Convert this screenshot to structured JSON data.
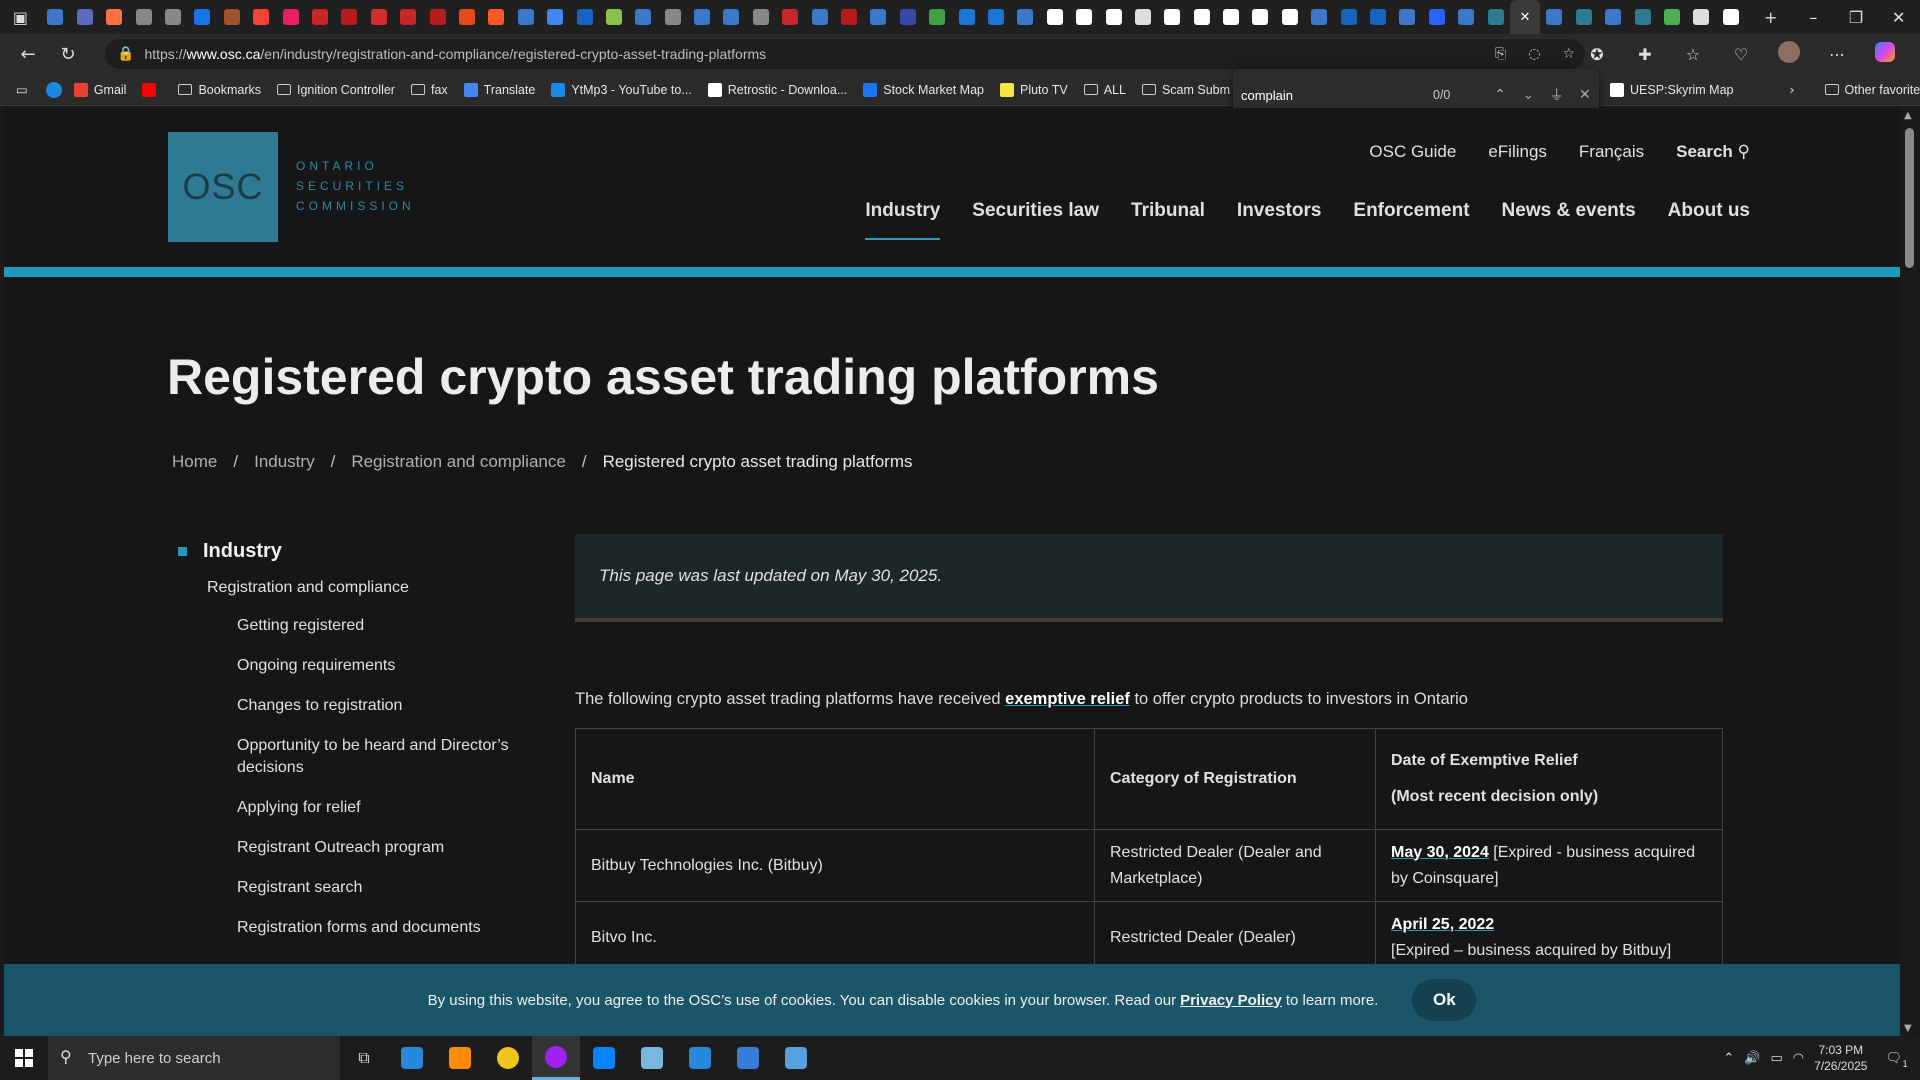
{
  "browser": {
    "tab_favicons": [
      "#3b78c9",
      "#5c6bc0",
      "#ff7043",
      "#888",
      "#888",
      "#1a73e8",
      "#a0522d",
      "#f44336",
      "#e91e63",
      "#c62828",
      "#b71c1c",
      "#d32f2f",
      "#c62828",
      "#b71c1c",
      "#e64a19",
      "#ff5722",
      "#3b78c9",
      "#4285f4",
      "#1565c0",
      "#8bc34a",
      "#3b78c9",
      "#888",
      "#3b78c9",
      "#3b78c9",
      "#888",
      "#c62828",
      "#3b78c9",
      "#b71c1c",
      "#3b78c9",
      "#3949ab",
      "#43a047",
      "#1976d2",
      "#1976d2",
      "#3b78c9",
      "#fff",
      "#fff",
      "#fff",
      "#ddd",
      "#fff",
      "#fff",
      "#fff",
      "#fff",
      "#fff",
      "#3b78c9",
      "#1565c0",
      "#1565c0",
      "#3b78c9",
      "#2962ff",
      "#3b78c9",
      "#2e7a92",
      "#3b78c9",
      "#2e7a92",
      "#3b78c9",
      "#2e7a92",
      "#4caf50",
      "#ddd",
      "#fff"
    ],
    "url_prefix": "https://",
    "url_host": "www.osc.ca",
    "url_path": "/en/industry/registration-and-compliance/registered-crypto-asset-trading-platforms",
    "bookmarks": [
      {
        "label": "Gmail",
        "color": "#ea4335",
        "folder": false
      },
      {
        "label": "",
        "color": "#ff0000",
        "folder": false
      },
      {
        "label": "Bookmarks",
        "color": "",
        "folder": true
      },
      {
        "label": "Ignition Controller",
        "color": "",
        "folder": true
      },
      {
        "label": "fax",
        "color": "",
        "folder": true
      },
      {
        "label": "Translate",
        "color": "#4285f4",
        "folder": false
      },
      {
        "label": "YtMp3 - YouTube to...",
        "color": "#1e88e5",
        "folder": false
      },
      {
        "label": "Retrostic - Downloa...",
        "color": "#ffffff",
        "folder": false
      },
      {
        "label": "Stock Market Map",
        "color": "#1877f2",
        "folder": false
      },
      {
        "label": "Pluto TV",
        "color": "#f5e642",
        "folder": false
      },
      {
        "label": "ALL",
        "color": "",
        "folder": true
      },
      {
        "label": "Scam Subm",
        "color": "",
        "folder": true
      }
    ],
    "bookmarks_right": [
      {
        "label": "UESP:Skyrim Map",
        "color": "#ffffff"
      }
    ],
    "other_favorites": "Other favorites",
    "find": {
      "query": "complain",
      "count": "0/0"
    }
  },
  "site": {
    "logo_abbr": "OSC",
    "logo_lines": [
      "ONTARIO",
      "SECURITIES",
      "COMMISSION"
    ],
    "util_nav": [
      "OSC Guide",
      "eFilings",
      "Français",
      "Search"
    ],
    "main_nav": [
      "Industry",
      "Securities law",
      "Tribunal",
      "Investors",
      "Enforcement",
      "News & events",
      "About us"
    ],
    "page_title": "Registered crypto asset trading platforms",
    "breadcrumb": [
      "Home",
      "Industry",
      "Registration and compliance",
      "Registered crypto asset trading platforms"
    ],
    "sidenav": {
      "heading": "Industry",
      "level1": "Registration and compliance",
      "items": [
        "Getting registered",
        "Ongoing requirements",
        "Changes to registration",
        "Opportunity to be heard and Director’s decisions",
        "Applying for relief",
        "Registrant Outreach program",
        "Registrant search",
        "Registration forms and documents"
      ]
    },
    "notice": "This page was last updated on May 30, 2025.",
    "intro_before": "The following crypto asset trading platforms have received ",
    "intro_link": "exemptive relief",
    "intro_after": " to offer crypto products to investors in Ontario",
    "table": {
      "headers": [
        "Name",
        "Category of Registration",
        "Date of Exemptive Relief",
        "(Most recent decision only)"
      ],
      "rows": [
        {
          "name": "Bitbuy Technologies Inc. (Bitbuy)",
          "category": "Restricted Dealer (Dealer and Marketplace)",
          "date": "May 30, 2024",
          "note": " [Expired - business acquired by Coinsquare]"
        },
        {
          "name": "Bitvo Inc.",
          "category": "Restricted Dealer (Dealer)",
          "date": "April 25, 2022",
          "note": "[Expired – business acquired by Bitbuy]"
        }
      ]
    },
    "cookie": {
      "text_before": "By using this website, you agree to the OSC’s use of cookies. You can disable cookies in your browser. Read our",
      "link": "Privacy Policy",
      "text_after": "to learn more.",
      "ok": "Ok"
    }
  },
  "taskbar": {
    "search_placeholder": "Type here to search",
    "apps": [
      "#2b88d8",
      "#ff8c00",
      "#f0c419",
      "#a020f0",
      "#0a84ff",
      "#7ab8e0",
      "#2b88d8",
      "#3a7bd5",
      "#5aa0e0"
    ],
    "time": "7:03 PM",
    "date": "7/26/2025",
    "notification_count": "1"
  }
}
